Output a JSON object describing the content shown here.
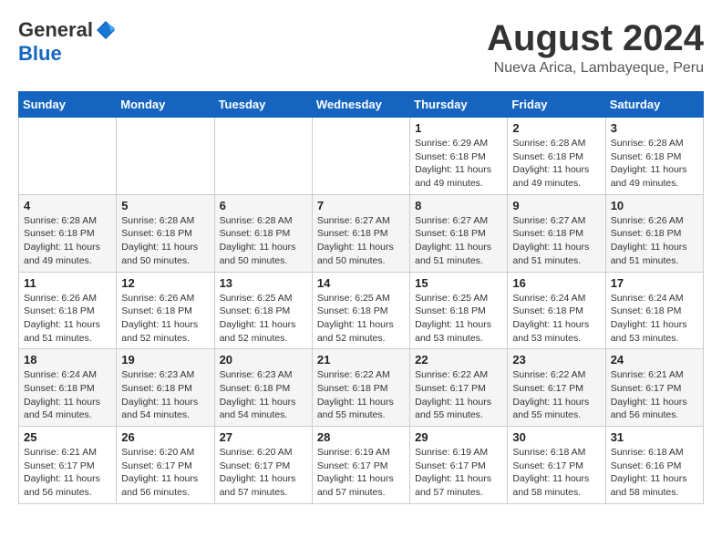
{
  "header": {
    "logo_general": "General",
    "logo_blue": "Blue",
    "month_year": "August 2024",
    "location": "Nueva Arica, Lambayeque, Peru"
  },
  "weekdays": [
    "Sunday",
    "Monday",
    "Tuesday",
    "Wednesday",
    "Thursday",
    "Friday",
    "Saturday"
  ],
  "weeks": [
    [
      {
        "day": "",
        "detail": ""
      },
      {
        "day": "",
        "detail": ""
      },
      {
        "day": "",
        "detail": ""
      },
      {
        "day": "",
        "detail": ""
      },
      {
        "day": "1",
        "detail": "Sunrise: 6:29 AM\nSunset: 6:18 PM\nDaylight: 11 hours and 49 minutes."
      },
      {
        "day": "2",
        "detail": "Sunrise: 6:28 AM\nSunset: 6:18 PM\nDaylight: 11 hours and 49 minutes."
      },
      {
        "day": "3",
        "detail": "Sunrise: 6:28 AM\nSunset: 6:18 PM\nDaylight: 11 hours and 49 minutes."
      }
    ],
    [
      {
        "day": "4",
        "detail": "Sunrise: 6:28 AM\nSunset: 6:18 PM\nDaylight: 11 hours and 49 minutes."
      },
      {
        "day": "5",
        "detail": "Sunrise: 6:28 AM\nSunset: 6:18 PM\nDaylight: 11 hours and 50 minutes."
      },
      {
        "day": "6",
        "detail": "Sunrise: 6:28 AM\nSunset: 6:18 PM\nDaylight: 11 hours and 50 minutes."
      },
      {
        "day": "7",
        "detail": "Sunrise: 6:27 AM\nSunset: 6:18 PM\nDaylight: 11 hours and 50 minutes."
      },
      {
        "day": "8",
        "detail": "Sunrise: 6:27 AM\nSunset: 6:18 PM\nDaylight: 11 hours and 51 minutes."
      },
      {
        "day": "9",
        "detail": "Sunrise: 6:27 AM\nSunset: 6:18 PM\nDaylight: 11 hours and 51 minutes."
      },
      {
        "day": "10",
        "detail": "Sunrise: 6:26 AM\nSunset: 6:18 PM\nDaylight: 11 hours and 51 minutes."
      }
    ],
    [
      {
        "day": "11",
        "detail": "Sunrise: 6:26 AM\nSunset: 6:18 PM\nDaylight: 11 hours and 51 minutes."
      },
      {
        "day": "12",
        "detail": "Sunrise: 6:26 AM\nSunset: 6:18 PM\nDaylight: 11 hours and 52 minutes."
      },
      {
        "day": "13",
        "detail": "Sunrise: 6:25 AM\nSunset: 6:18 PM\nDaylight: 11 hours and 52 minutes."
      },
      {
        "day": "14",
        "detail": "Sunrise: 6:25 AM\nSunset: 6:18 PM\nDaylight: 11 hours and 52 minutes."
      },
      {
        "day": "15",
        "detail": "Sunrise: 6:25 AM\nSunset: 6:18 PM\nDaylight: 11 hours and 53 minutes."
      },
      {
        "day": "16",
        "detail": "Sunrise: 6:24 AM\nSunset: 6:18 PM\nDaylight: 11 hours and 53 minutes."
      },
      {
        "day": "17",
        "detail": "Sunrise: 6:24 AM\nSunset: 6:18 PM\nDaylight: 11 hours and 53 minutes."
      }
    ],
    [
      {
        "day": "18",
        "detail": "Sunrise: 6:24 AM\nSunset: 6:18 PM\nDaylight: 11 hours and 54 minutes."
      },
      {
        "day": "19",
        "detail": "Sunrise: 6:23 AM\nSunset: 6:18 PM\nDaylight: 11 hours and 54 minutes."
      },
      {
        "day": "20",
        "detail": "Sunrise: 6:23 AM\nSunset: 6:18 PM\nDaylight: 11 hours and 54 minutes."
      },
      {
        "day": "21",
        "detail": "Sunrise: 6:22 AM\nSunset: 6:18 PM\nDaylight: 11 hours and 55 minutes."
      },
      {
        "day": "22",
        "detail": "Sunrise: 6:22 AM\nSunset: 6:17 PM\nDaylight: 11 hours and 55 minutes."
      },
      {
        "day": "23",
        "detail": "Sunrise: 6:22 AM\nSunset: 6:17 PM\nDaylight: 11 hours and 55 minutes."
      },
      {
        "day": "24",
        "detail": "Sunrise: 6:21 AM\nSunset: 6:17 PM\nDaylight: 11 hours and 56 minutes."
      }
    ],
    [
      {
        "day": "25",
        "detail": "Sunrise: 6:21 AM\nSunset: 6:17 PM\nDaylight: 11 hours and 56 minutes."
      },
      {
        "day": "26",
        "detail": "Sunrise: 6:20 AM\nSunset: 6:17 PM\nDaylight: 11 hours and 56 minutes."
      },
      {
        "day": "27",
        "detail": "Sunrise: 6:20 AM\nSunset: 6:17 PM\nDaylight: 11 hours and 57 minutes."
      },
      {
        "day": "28",
        "detail": "Sunrise: 6:19 AM\nSunset: 6:17 PM\nDaylight: 11 hours and 57 minutes."
      },
      {
        "day": "29",
        "detail": "Sunrise: 6:19 AM\nSunset: 6:17 PM\nDaylight: 11 hours and 57 minutes."
      },
      {
        "day": "30",
        "detail": "Sunrise: 6:18 AM\nSunset: 6:17 PM\nDaylight: 11 hours and 58 minutes."
      },
      {
        "day": "31",
        "detail": "Sunrise: 6:18 AM\nSunset: 6:16 PM\nDaylight: 11 hours and 58 minutes."
      }
    ]
  ]
}
